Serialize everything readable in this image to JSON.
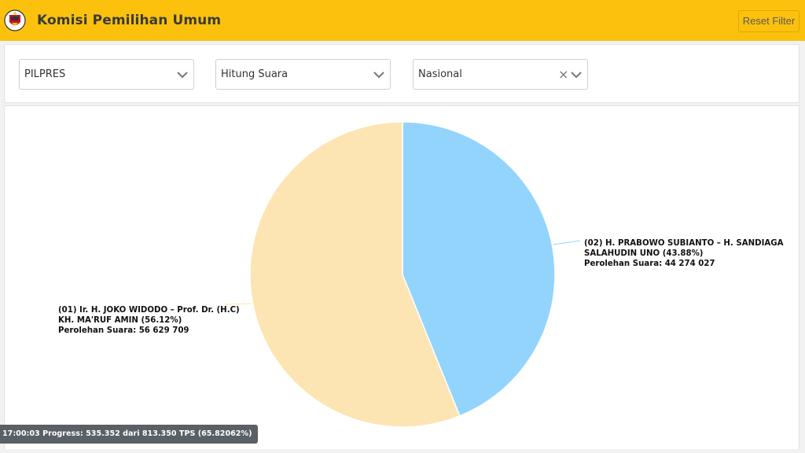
{
  "header": {
    "title": "Komisi Pemilihan Umum",
    "reset_label": "Reset Filter"
  },
  "filters": {
    "election": "PILPRES",
    "mode": "Hitung Suara",
    "region": "Nasional"
  },
  "chart_data": {
    "type": "pie",
    "title": "",
    "categories": [
      "(01) Ir. H. JOKO WIDODO - Prof. Dr. (H.C) KH. MA'RUF AMIN",
      "(02) H. PRABOWO SUBIANTO - H. SANDIAGA SALAHUDIN UNO"
    ],
    "values": [
      56629709,
      44274027
    ],
    "percent": [
      56.12,
      43.88
    ],
    "colors": [
      "#fde4b3",
      "#92d4fc"
    ],
    "labels": [
      {
        "line1": "(01) Ir. H. JOKO WIDODO – Prof. Dr. (H.C)",
        "line2": "KH. MA'RUF AMIN (56.12%)",
        "line3": "Perolehan Suara: 56 629 709"
      },
      {
        "line1": "(02) H. PRABOWO SUBIANTO – H. SANDIAGA",
        "line2": "SALAHUDIN UNO (43.88%)",
        "line3": "Perolehan Suara: 44 274 027"
      }
    ]
  },
  "status": {
    "progress_text": "17:00:03 Progress: 535.352 dari 813.350 TPS (65.82062%)"
  }
}
